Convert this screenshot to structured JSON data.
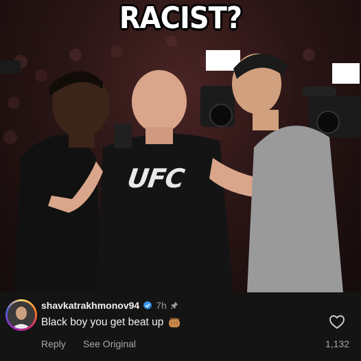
{
  "post": {
    "headline": "RACIST?",
    "shirt_logo": "UFC"
  },
  "comment": {
    "username": "shavkatrakhmonov94",
    "verified": true,
    "time": "7h",
    "pinned": true,
    "text": "Black boy you get beat up",
    "emoji": "oncoming-fist-icon",
    "reply_label": "Reply",
    "see_original_label": "See Original",
    "like_count": "1,132",
    "verified_color": "#3897f0"
  }
}
